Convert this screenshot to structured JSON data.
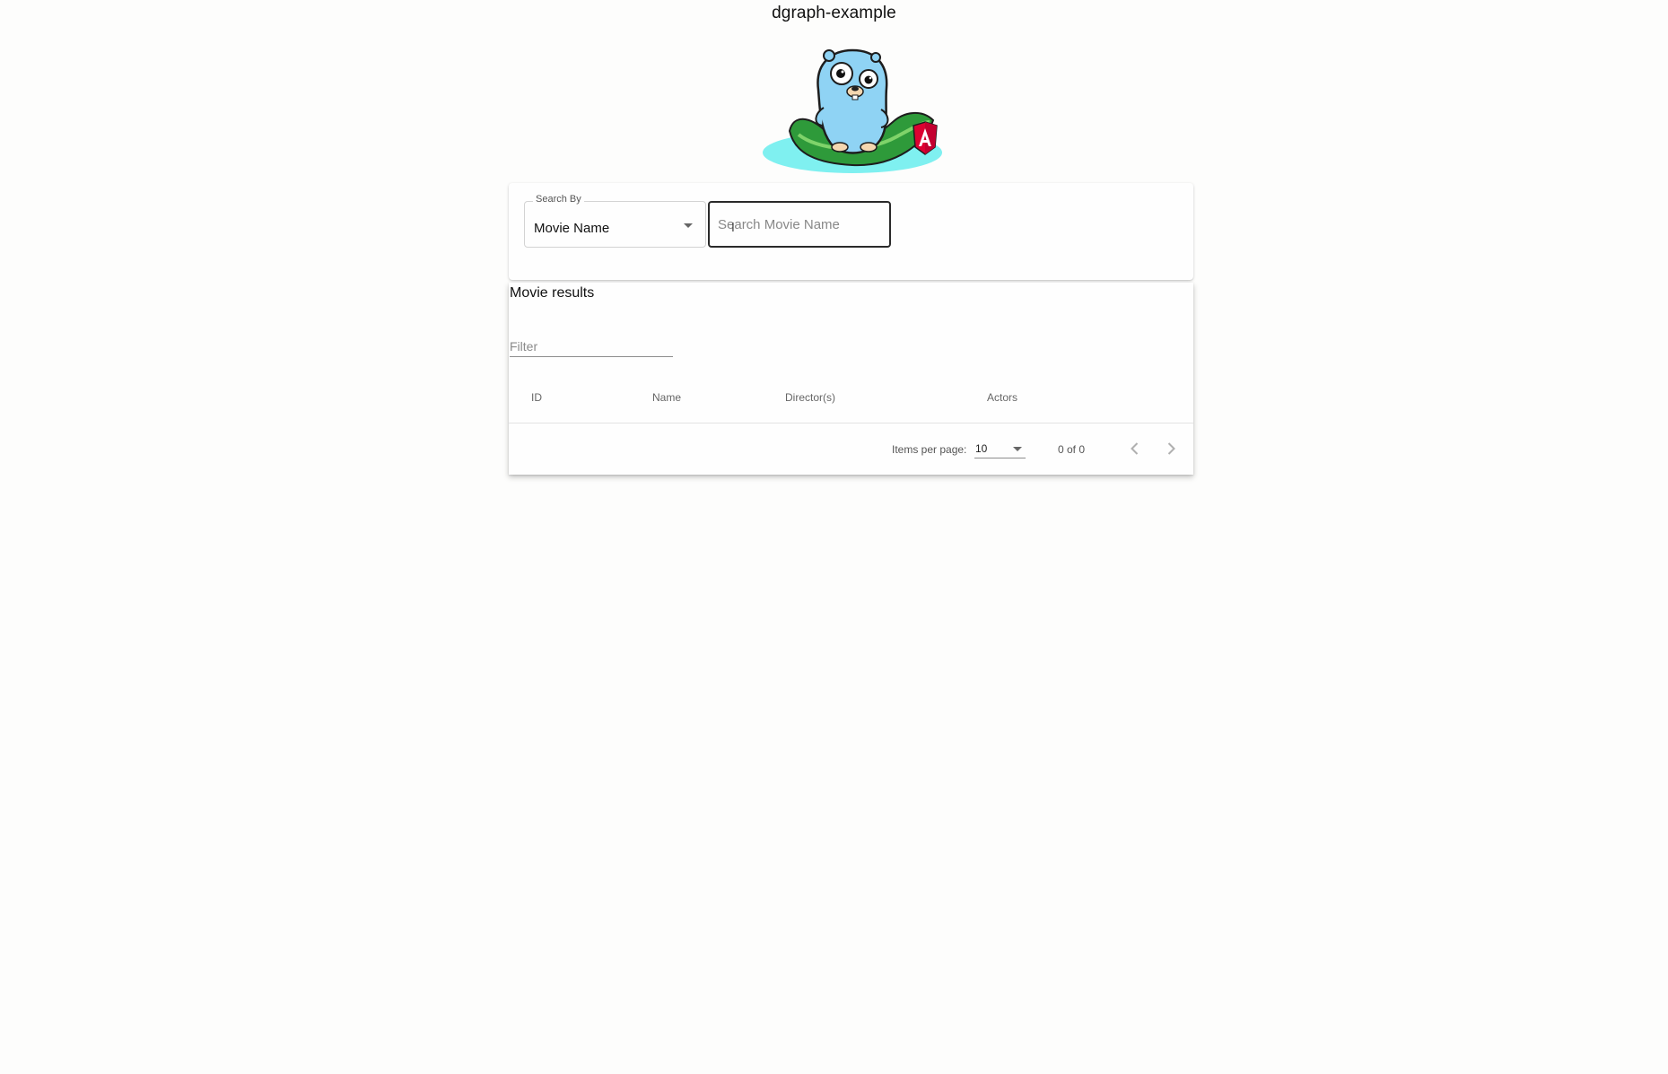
{
  "header": {
    "title": "dgraph-example",
    "logo_icon": "gopher-angular-logo"
  },
  "search": {
    "search_by_label": "Search By",
    "search_by_value": "Movie Name",
    "input_placeholder": "Search Movie Name",
    "input_value": ""
  },
  "results": {
    "title": "Movie results",
    "filter_placeholder": "Filter",
    "columns": [
      "ID",
      "Name",
      "Director(s)",
      "Actors"
    ],
    "rows": []
  },
  "paginator": {
    "items_per_page_label": "Items per page:",
    "items_per_page_value": "10",
    "range_label": "0 of 0",
    "prev_icon": "chevron-left-icon",
    "next_icon": "chevron-right-icon"
  },
  "colors": {
    "accent_dark": "#2a2a2a",
    "gopher_blue": "#8fd3f4",
    "leaf_green": "#3fae49",
    "angular_red": "#dd0031",
    "water_cyan": "#7ff0f0"
  }
}
